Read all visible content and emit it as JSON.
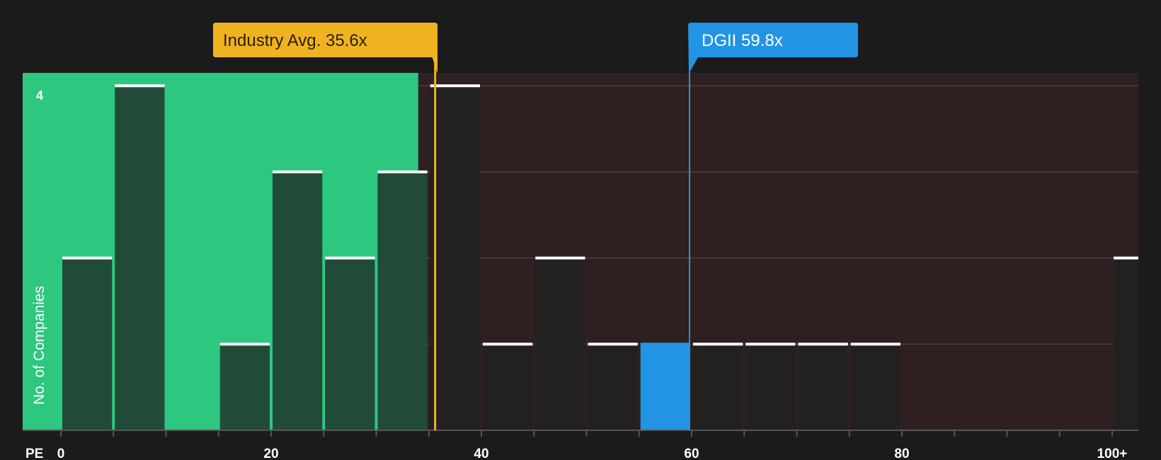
{
  "colors": {
    "background": "#1b1b1b",
    "fair_region": "#2ec780",
    "over_region": "#2f1f20",
    "bar_fair": "#214a38",
    "bar_over": "#232020",
    "bar_highlight": "#2394e3",
    "bar_cap": "#ffffff",
    "industry_line": "#efb321",
    "company_line": "#2394e3",
    "gridline": "#4a4040",
    "axis": "#555555"
  },
  "chart_data": {
    "type": "bar",
    "x_axis_label": "PE",
    "ylabel": "No. of Companies",
    "ylim": [
      0,
      4
    ],
    "y_tick_labels": [
      {
        "value": 4,
        "text": "4"
      }
    ],
    "x_tick_labels": [
      {
        "value": 0,
        "text": "0"
      },
      {
        "value": 20,
        "text": "20"
      },
      {
        "value": 40,
        "text": "40"
      },
      {
        "value": 60,
        "text": "60"
      },
      {
        "value": 80,
        "text": "80"
      },
      {
        "value": 100,
        "text": "100+"
      }
    ],
    "bin_width": 5,
    "bins": [
      {
        "start": 0,
        "count": 2
      },
      {
        "start": 5,
        "count": 4
      },
      {
        "start": 10,
        "count": 0
      },
      {
        "start": 15,
        "count": 1
      },
      {
        "start": 20,
        "count": 3
      },
      {
        "start": 25,
        "count": 2
      },
      {
        "start": 30,
        "count": 3
      },
      {
        "start": 35,
        "count": 4
      },
      {
        "start": 40,
        "count": 1
      },
      {
        "start": 45,
        "count": 2
      },
      {
        "start": 50,
        "count": 1
      },
      {
        "start": 55,
        "count": 1,
        "highlight": true
      },
      {
        "start": 60,
        "count": 1
      },
      {
        "start": 65,
        "count": 1
      },
      {
        "start": 70,
        "count": 1
      },
      {
        "start": 75,
        "count": 1
      },
      {
        "start": 80,
        "count": 0
      },
      {
        "start": 85,
        "count": 0
      },
      {
        "start": 90,
        "count": 0
      },
      {
        "start": 95,
        "count": 0
      },
      {
        "start": 100,
        "count": 2
      }
    ],
    "fair_region_end": 34,
    "industry_avg": {
      "value": 35.6,
      "label": "Industry Avg. 35.6x"
    },
    "company": {
      "ticker": "DGII",
      "value": 59.8,
      "label": "DGII 59.8x"
    }
  }
}
